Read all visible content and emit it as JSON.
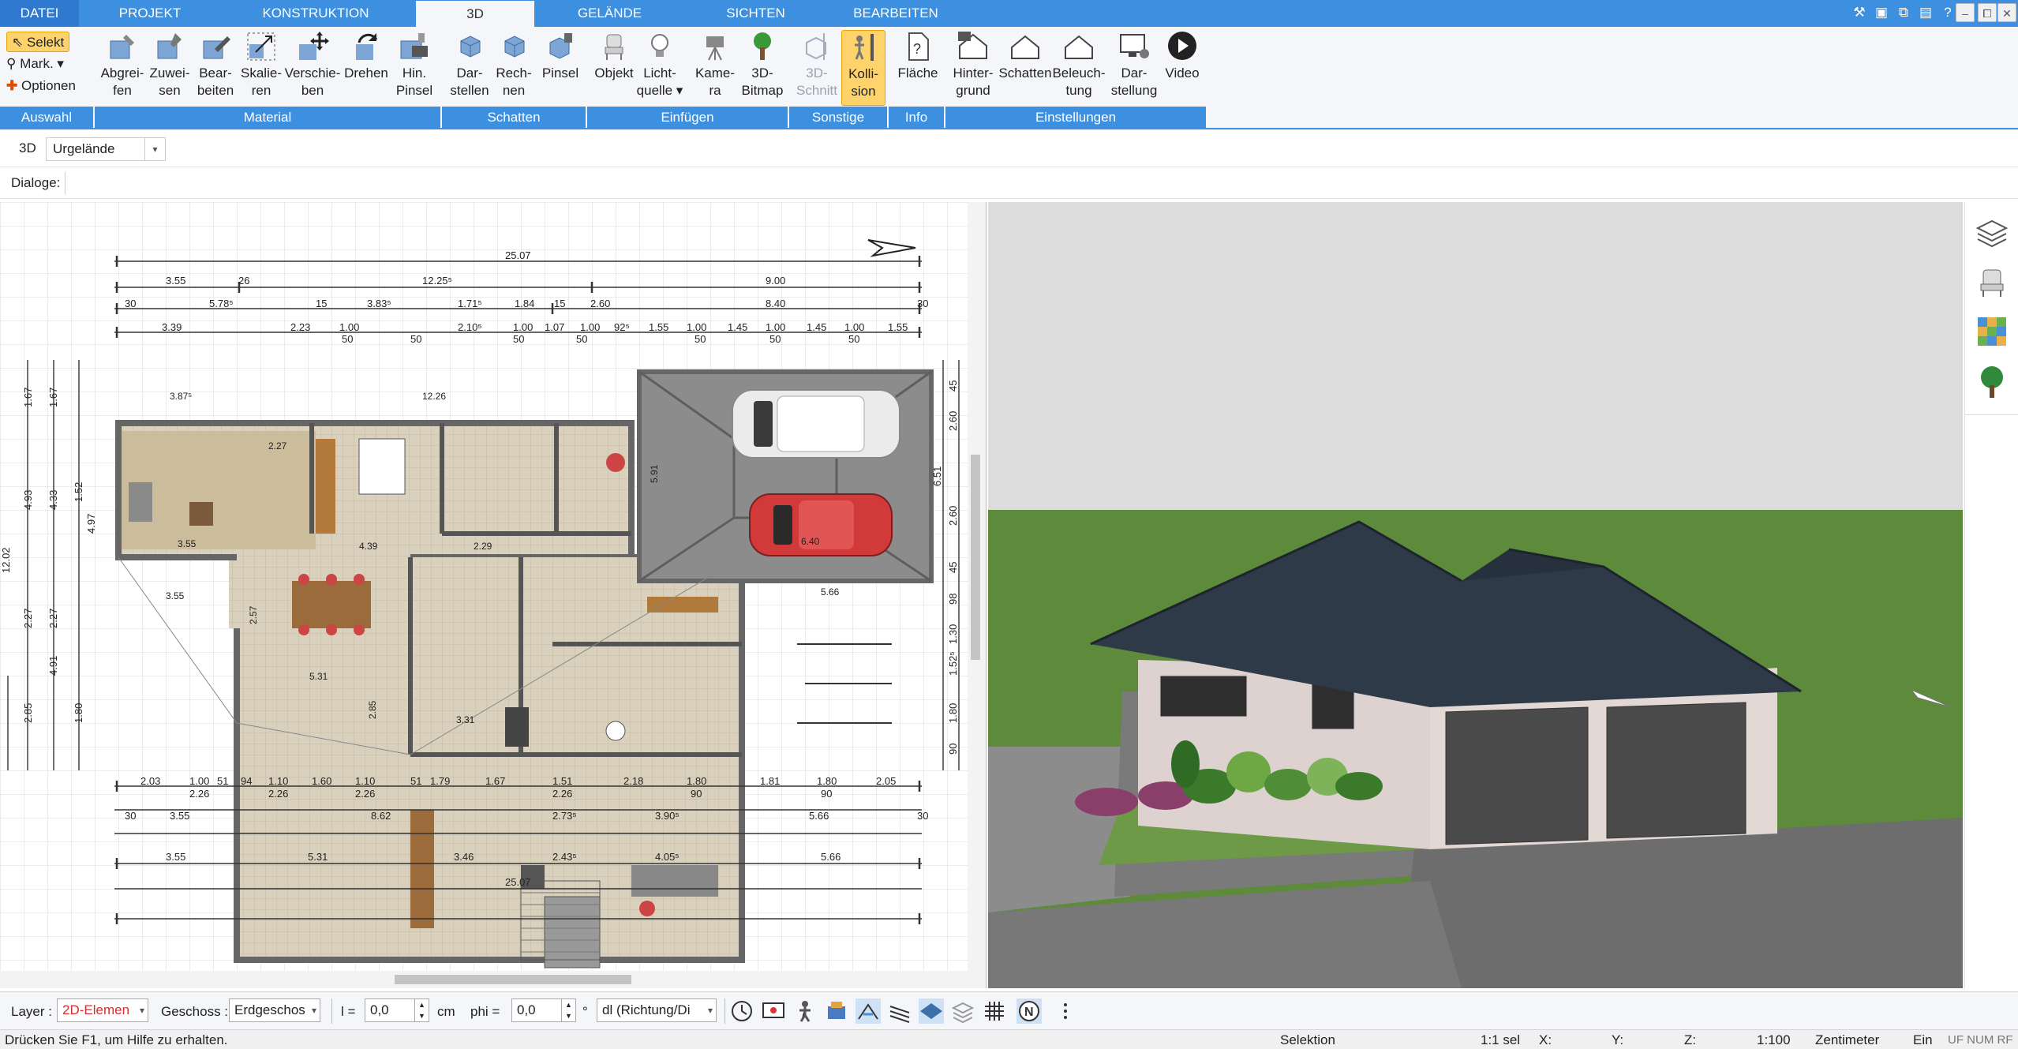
{
  "tabs": [
    "DATEI",
    "PROJEKT",
    "KONSTRUKTION",
    "3D",
    "GELÄNDE",
    "SICHTEN",
    "BEARBEITEN"
  ],
  "ribbon": {
    "auswahl": {
      "selekt": "Selekt",
      "mark": "Mark.",
      "optionen": "Optionen"
    },
    "buttons": {
      "abgreifen": [
        "Abgrei-",
        "fen"
      ],
      "zuweisen": [
        "Zuwei-",
        "sen"
      ],
      "bearbeiten": [
        "Bear-",
        "beiten"
      ],
      "skalieren": [
        "Skalie-",
        "ren"
      ],
      "verschieben": [
        "Verschie-",
        "ben"
      ],
      "drehen": [
        "Drehen",
        ""
      ],
      "hin_pinsel": [
        "Hin.",
        "Pinsel"
      ],
      "darstellen": [
        "Dar-",
        "stellen"
      ],
      "rechnen": [
        "Rech-",
        "nen"
      ],
      "pinsel": [
        "Pinsel",
        ""
      ],
      "objekt": [
        "Objekt",
        ""
      ],
      "lichtquelle": [
        "Licht-",
        "quelle"
      ],
      "kamera": [
        "Kame-",
        "ra"
      ],
      "bitmap3d": [
        "3D-",
        "Bitmap"
      ],
      "schnitt3d": [
        "3D-",
        "Schnitt"
      ],
      "kollision": [
        "Kolli-",
        "sion"
      ],
      "flaeche": [
        "Fläche",
        ""
      ],
      "hintergrund": [
        "Hinter-",
        "grund"
      ],
      "schatten2": [
        "Schatten",
        ""
      ],
      "beleuchtung": [
        "Beleuch-",
        "tung"
      ],
      "darstellung": [
        "Dar-",
        "stellung"
      ],
      "video": [
        "Video",
        ""
      ]
    },
    "groups": [
      "Auswahl",
      "Material",
      "Schatten",
      "Einfügen",
      "Sonstige",
      "Info",
      "Einstellungen"
    ]
  },
  "toolbar3d": {
    "label": "3D",
    "dropdown": "Urgelände"
  },
  "dialoge": "Dialoge:",
  "plan": {
    "dims_top": {
      "overall": "25.07",
      "r1": [
        "3.55",
        "26",
        "12.25⁵",
        "9.00"
      ],
      "r2": [
        "30",
        "5.78⁵",
        "15",
        "3.83⁵",
        "1.71⁵",
        "1.84",
        "15",
        "2.60",
        "8.40",
        "30"
      ],
      "r3": [
        "3.39",
        "2.23",
        "1.00",
        "50",
        "2.10⁵",
        "1.00",
        "1.07",
        "1.00",
        "92⁵",
        "1.55",
        "1.00",
        "50",
        "1.45",
        "1.00",
        "1.45",
        "1.00",
        "1.55",
        "50",
        "50",
        "50",
        "50",
        "50"
      ]
    },
    "dims_bottom": {
      "r1": [
        "2.03",
        "1.00",
        "51",
        "94",
        "1.10",
        "1.60",
        "1.10",
        "51",
        "1.79",
        "1.67",
        "1.51",
        "2.18",
        "1.80",
        "1.81",
        "1.80",
        "2.05"
      ],
      "r1b": [
        "2.26",
        "2.26",
        "2.26",
        "2.26",
        "90",
        "90"
      ],
      "r2": [
        "30",
        "3.55",
        "8.62",
        "2.73⁵",
        "3.90⁵",
        "5.66",
        "30"
      ],
      "r3": [
        "3.55",
        "5.31",
        "3.46",
        "2.43⁵",
        "4.05⁵",
        "5.66"
      ],
      "overall": "25.07"
    },
    "dims_left": [
      "1.67",
      "1.67",
      "4.93",
      "4.33",
      "1.52",
      "4.97",
      "2.27",
      "2.27",
      "4.91",
      "2.85",
      "1.80",
      "12.02"
    ],
    "dims_right": [
      "45",
      "2.60",
      "6.51",
      "2.60",
      "45",
      "98",
      "1.30",
      "1.52⁵",
      "1.80",
      "90"
    ],
    "room_labels": [
      "3.87⁵",
      "12.26",
      "2.27",
      "3.55",
      "4.39",
      "2.29",
      "3.55",
      "2.57",
      "5.31",
      "2.85",
      "3.31",
      "5.66",
      "5.91",
      "6.40"
    ]
  },
  "bottombar": {
    "layer_label": "Layer :",
    "layer_value": "2D-Elemen",
    "geschoss_label": "Geschoss :",
    "geschoss_value": "Erdgeschos",
    "l_label": "l =",
    "l_value": "0,0",
    "l_unit": "cm",
    "phi_label": "phi =",
    "phi_value": "0,0",
    "phi_unit": "°",
    "direction": "dl (Richtung/Di"
  },
  "status": {
    "help": "Drücken Sie F1, um Hilfe zu erhalten.",
    "mode": "Selektion",
    "sel": "1:1 sel",
    "x": "X:",
    "y": "Y:",
    "z": "Z:",
    "scale": "1:100",
    "unit": "Zentimeter",
    "ein": "Ein",
    "flags": "UF  NUM  RF"
  },
  "colors": {
    "accent": "#3d8fe0",
    "highlight": "#ffd36b",
    "layerRed": "#d32f2f",
    "roof": "#2e3a47",
    "grass": "#5e8a3c"
  }
}
